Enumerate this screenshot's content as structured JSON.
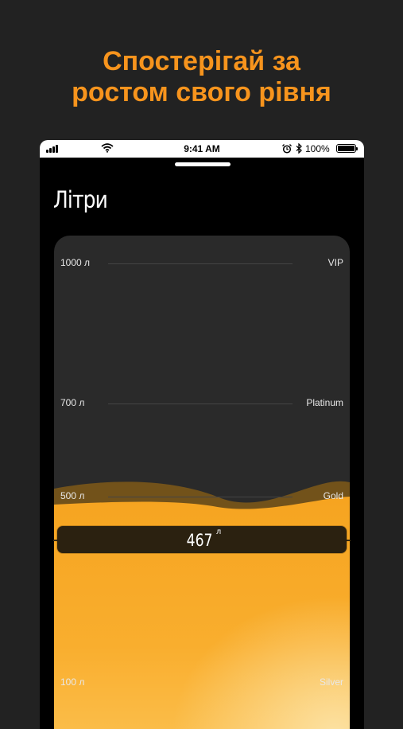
{
  "promo": {
    "title_line1": "Спостерігай за",
    "title_line2": "ростом свого рівня",
    "color": "#F7941D"
  },
  "status_bar": {
    "time": "9:41 AM",
    "battery_percent": "100%",
    "icons": [
      "signal-icon",
      "wifi-icon",
      "alarm-icon",
      "bluetooth-icon",
      "battery-icon"
    ]
  },
  "screen": {
    "title": "Літри"
  },
  "levels": [
    {
      "amount": "1000 л",
      "name": "VIP"
    },
    {
      "amount": "700 л",
      "name": "Platinum"
    },
    {
      "amount": "500 л",
      "name": "Gold"
    },
    {
      "amount": "100 л",
      "name": "Silver"
    }
  ],
  "current": {
    "value": "467",
    "unit": "л"
  },
  "colors": {
    "background": "#222222",
    "card": "#2a2a2a",
    "fill_orange": "#F9A51E",
    "fill_light": "#FCD57E"
  }
}
